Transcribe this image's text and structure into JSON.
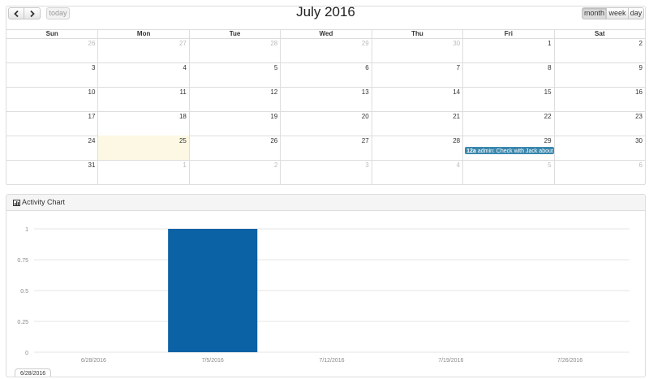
{
  "calendar": {
    "title": "July 2016",
    "today_label": "today",
    "views": {
      "month": "month",
      "week": "week",
      "day": "day"
    },
    "weekdays": [
      "Sun",
      "Mon",
      "Tue",
      "Wed",
      "Thu",
      "Fri",
      "Sat"
    ],
    "weeks": [
      [
        {
          "d": "26",
          "o": true
        },
        {
          "d": "27",
          "o": true
        },
        {
          "d": "28",
          "o": true
        },
        {
          "d": "29",
          "o": true
        },
        {
          "d": "30",
          "o": true
        },
        {
          "d": "1"
        },
        {
          "d": "2"
        }
      ],
      [
        {
          "d": "3"
        },
        {
          "d": "4"
        },
        {
          "d": "5"
        },
        {
          "d": "6"
        },
        {
          "d": "7"
        },
        {
          "d": "8"
        },
        {
          "d": "9"
        }
      ],
      [
        {
          "d": "10"
        },
        {
          "d": "11"
        },
        {
          "d": "12"
        },
        {
          "d": "13"
        },
        {
          "d": "14"
        },
        {
          "d": "15"
        },
        {
          "d": "16"
        }
      ],
      [
        {
          "d": "17"
        },
        {
          "d": "18"
        },
        {
          "d": "19"
        },
        {
          "d": "20"
        },
        {
          "d": "21"
        },
        {
          "d": "22"
        },
        {
          "d": "23"
        }
      ],
      [
        {
          "d": "24"
        },
        {
          "d": "25",
          "today": true
        },
        {
          "d": "26"
        },
        {
          "d": "27"
        },
        {
          "d": "28"
        },
        {
          "d": "29"
        },
        {
          "d": "30"
        }
      ],
      [
        {
          "d": "31"
        },
        {
          "d": "1",
          "o": true
        },
        {
          "d": "2",
          "o": true
        },
        {
          "d": "3",
          "o": true
        },
        {
          "d": "4",
          "o": true
        },
        {
          "d": "5",
          "o": true
        },
        {
          "d": "6",
          "o": true
        }
      ]
    ],
    "event": {
      "time": "12a",
      "text": "admin: Check with Jack about co",
      "color": "#3a87ad"
    }
  },
  "activity_chart": {
    "title": "Activity Chart",
    "tooltip_label": "6/28/2016"
  },
  "chart_data": {
    "type": "bar",
    "categories": [
      "6/28/2016",
      "7/5/2016",
      "7/12/2016",
      "7/19/2016",
      "7/26/2016"
    ],
    "values": [
      0,
      1,
      0,
      0,
      0
    ],
    "yticks": [
      "0",
      "0.25",
      "0.5",
      "0.75",
      "1"
    ],
    "ylim": [
      0,
      1
    ],
    "bar_color": "#0b62a4",
    "grid": true
  }
}
